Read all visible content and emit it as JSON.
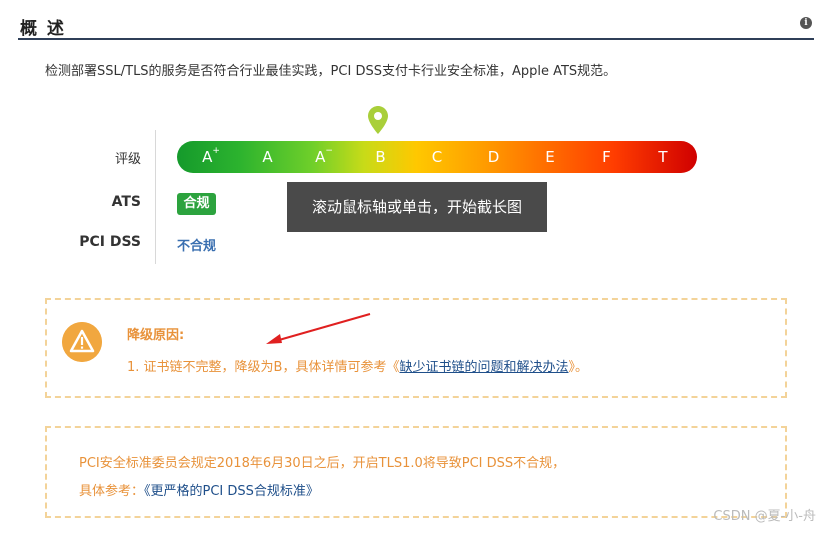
{
  "header": {
    "title": "概 述",
    "info_icon": "info-icon"
  },
  "description": "检测部署SSL/TLS的服务是否符合行业最佳实践，PCI DSS支付卡行业安全标准，Apple ATS规范。",
  "labels": {
    "grade": "评级",
    "ats": "ATS",
    "pci": "PCI DSS"
  },
  "grades": [
    {
      "base": "A",
      "sup": "+"
    },
    {
      "base": "A",
      "sup": ""
    },
    {
      "base": "A",
      "sup": "−"
    },
    {
      "base": "B",
      "sup": ""
    },
    {
      "base": "C",
      "sup": ""
    },
    {
      "base": "D",
      "sup": ""
    },
    {
      "base": "E",
      "sup": ""
    },
    {
      "base": "F",
      "sup": ""
    },
    {
      "base": "T",
      "sup": ""
    }
  ],
  "current_grade": "B",
  "ats_badge": "合规",
  "pci_value": "不合规",
  "tooltip": "滚动鼠标轴或单击，开始截长图",
  "downgrade": {
    "title": "降级原因:",
    "reason_prefix": "1. 证书链不完整，降级为B，具体详情可参考",
    "link_open": "《",
    "link_text": "缺少证书链的问题和解决办法",
    "link_close": "》。"
  },
  "pci_notice": {
    "line1": "PCI安全标准委员会规定2018年6月30日之后，开启TLS1.0将导致PCI DSS不合规，",
    "line2_prefix": "具体参考：",
    "line2_link": "《更严格的PCI DSS合规标准》"
  },
  "watermark": "CSDN @夏-小-舟",
  "colors": {
    "accent": "#2f3f58",
    "ats_badge": "#2ca33e",
    "warning": "#e8923a",
    "link": "#1f4f8a",
    "pin": "#a9cf3a"
  }
}
